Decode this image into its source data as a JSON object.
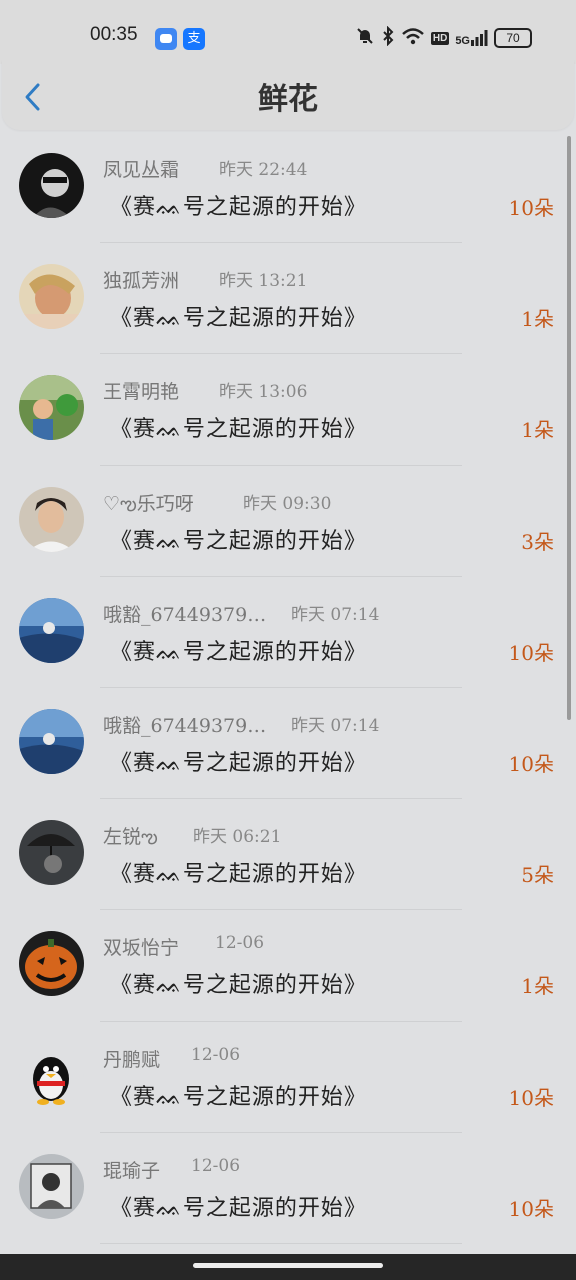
{
  "status_bar": {
    "time": "00:35",
    "app_icons": [
      "message-app-icon",
      "alipay-app-icon"
    ],
    "alipay_glyph": "支",
    "hd": "HD",
    "network": "5G",
    "battery": "70"
  },
  "header": {
    "title": "鲜花"
  },
  "list": [
    {
      "sender": "凤见丛霜",
      "time": "昨天 22:44",
      "message": "《赛ᨐ号之起源的开始》",
      "count": "10朵",
      "avatar": "avatar-dark-sunglasses"
    },
    {
      "sender": "独孤芳洲",
      "time": "昨天 13:21",
      "message": "《赛ᨐ号之起源的开始》",
      "count": "1朵",
      "avatar": "avatar-blonde-woman"
    },
    {
      "sender": "王霄明艳",
      "time": "昨天 13:06",
      "message": "《赛ᨐ号之起源的开始》",
      "count": "1朵",
      "avatar": "avatar-child-outdoor"
    },
    {
      "sender": "♡ఌ乐巧呀",
      "time": "昨天 09:30",
      "message": "《赛ᨐ号之起源的开始》",
      "count": "3朵",
      "avatar": "avatar-woman-selfie"
    },
    {
      "sender": "哦豁_67449379…",
      "time": "昨天 07:14",
      "message": "《赛ᨐ号之起源的开始》",
      "count": "10朵",
      "avatar": "avatar-blue-sea"
    },
    {
      "sender": "哦豁_67449379…",
      "time": "昨天 07:14",
      "message": "《赛ᨐ号之起源的开始》",
      "count": "10朵",
      "avatar": "avatar-blue-sea"
    },
    {
      "sender": "左锐ఌ",
      "time": "昨天 06:21",
      "message": "《赛ᨐ号之起源的开始》",
      "count": "5朵",
      "avatar": "avatar-rain-umbrella"
    },
    {
      "sender": "双坂怡宁",
      "time": "12-06",
      "message": "《赛ᨐ号之起源的开始》",
      "count": "1朵",
      "avatar": "avatar-pumpkin"
    },
    {
      "sender": "丹鹏赋",
      "time": "12-06",
      "message": "《赛ᨐ号之起源的开始》",
      "count": "10朵",
      "avatar": "avatar-qq-penguin"
    },
    {
      "sender": "琨瑜子",
      "time": "12-06",
      "message": "《赛ᨐ号之起源的开始》",
      "count": "10朵",
      "avatar": "avatar-sketch"
    }
  ]
}
